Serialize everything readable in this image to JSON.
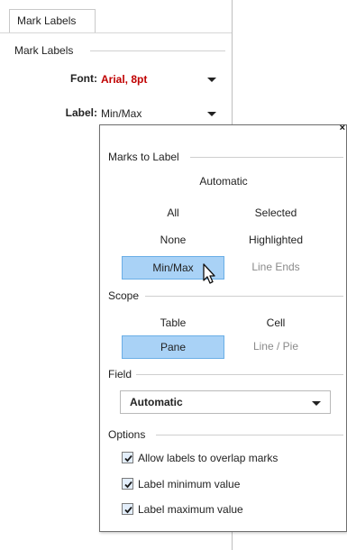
{
  "left_panel": {
    "tab_label": "Mark Labels",
    "group_title": "Mark Labels",
    "font_label": "Font:",
    "font_value": "Arial, 8pt",
    "label_label": "Label:",
    "label_value": "Min/Max"
  },
  "popup": {
    "marks_to_label": {
      "title": "Marks to Label",
      "automatic": "Automatic",
      "all": "All",
      "selected": "Selected",
      "none": "None",
      "highlighted": "Highlighted",
      "minmax": "Min/Max",
      "line_ends": "Line Ends"
    },
    "scope": {
      "title": "Scope",
      "table": "Table",
      "cell": "Cell",
      "pane": "Pane",
      "line_pie": "Line / Pie"
    },
    "field": {
      "title": "Field",
      "value": "Automatic"
    },
    "options": {
      "title": "Options",
      "items": [
        {
          "label": "Allow labels to overlap marks",
          "checked": true
        },
        {
          "label": "Label minimum value",
          "checked": true
        },
        {
          "label": "Label maximum value",
          "checked": true
        }
      ]
    }
  },
  "colors": {
    "font_value": "#c00000",
    "selected_fill": "#a9d2f6",
    "selected_border": "#6aaee6"
  },
  "icons": [
    "close-icon",
    "chevron-down-icon",
    "checkmark-icon",
    "pointer-cursor-icon"
  ]
}
